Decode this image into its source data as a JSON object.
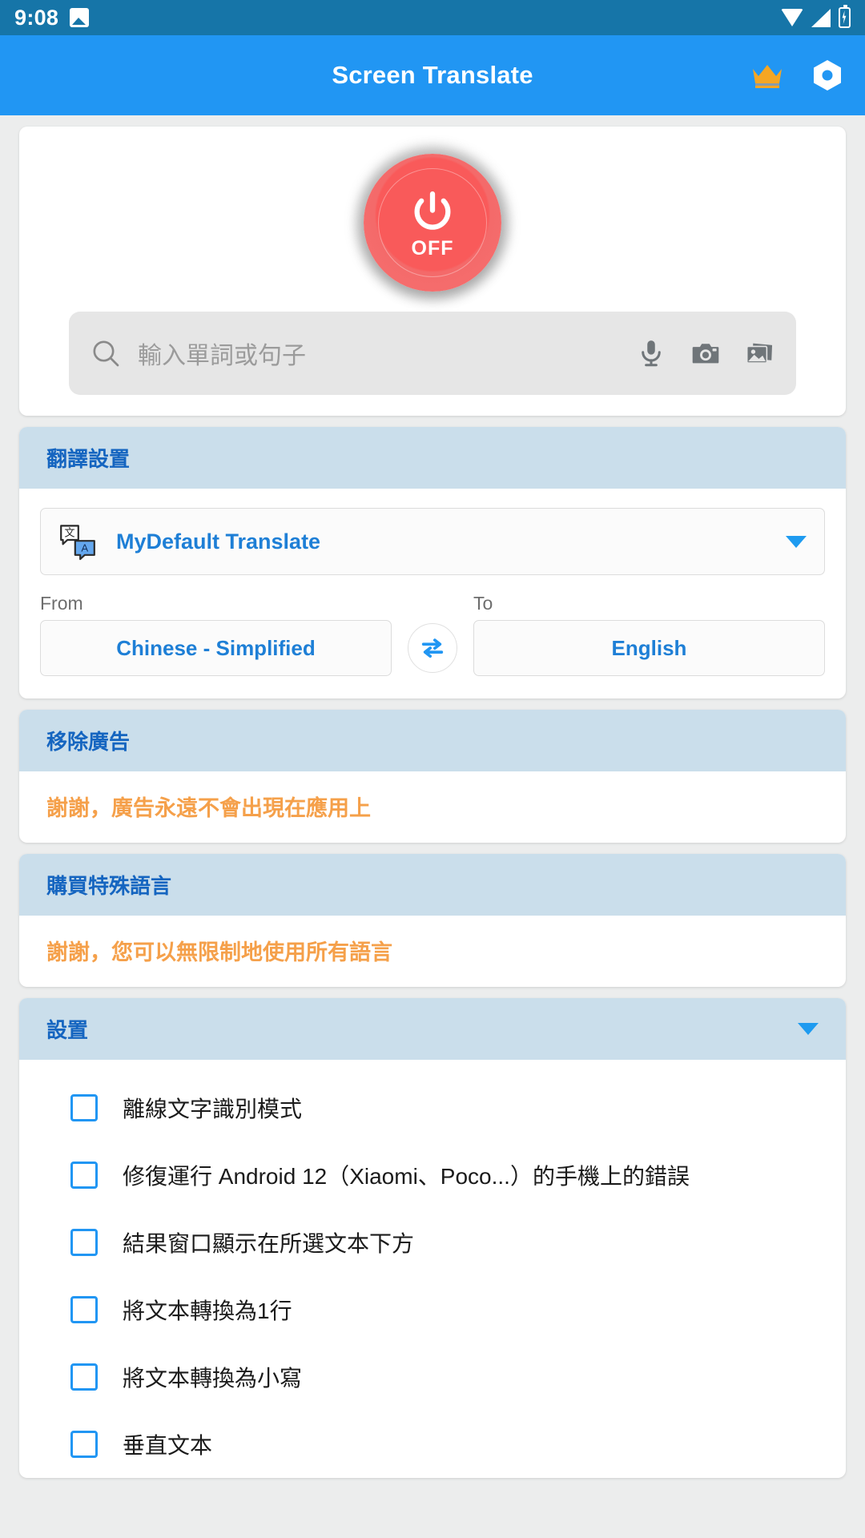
{
  "status_bar": {
    "time": "9:08",
    "icons": [
      "photo-icon",
      "wifi-icon",
      "signal-icon",
      "battery-charging-icon"
    ]
  },
  "app_bar": {
    "title": "Screen Translate",
    "crown_label": "crown-icon",
    "gear_label": "gear-icon",
    "background": "#2196f3"
  },
  "power": {
    "state_label": "OFF",
    "color": "#f95a5a"
  },
  "search": {
    "placeholder": "輸入單詞或句子",
    "value": "",
    "actions": [
      "mic-icon",
      "camera-icon",
      "gallery-icon"
    ]
  },
  "translate_settings": {
    "header": "翻譯設置",
    "engine": "MyDefault Translate",
    "from_label": "From",
    "from_value": "Chinese - Simplified",
    "to_label": "To",
    "to_value": "English",
    "swap_label": "swap-languages-icon"
  },
  "remove_ads": {
    "header": "移除廣告",
    "message": "謝謝，廣告永遠不會出現在應用上"
  },
  "buy_languages": {
    "header": "購買特殊語言",
    "message": "謝謝，您可以無限制地使用所有語言"
  },
  "settings": {
    "header": "設置",
    "items": [
      {
        "label": "離線文字識別模式",
        "checked": false
      },
      {
        "label": "修復運行 Android 12（Xiaomi、Poco...）的手機上的錯誤",
        "checked": false
      },
      {
        "label": "結果窗口顯示在所選文本下方",
        "checked": false
      },
      {
        "label": "將文本轉換為1行",
        "checked": false
      },
      {
        "label": "將文本轉換為小寫",
        "checked": false
      },
      {
        "label": "垂直文本",
        "checked": false
      }
    ]
  },
  "colors": {
    "accent": "#2196f3",
    "status_bar": "#1675a8",
    "section_header_bg": "#cadeeb",
    "section_header_text": "#1565c0",
    "promo_text": "#f5a04a",
    "power_red": "#f95a5a",
    "crown_gold": "#f5a623"
  }
}
